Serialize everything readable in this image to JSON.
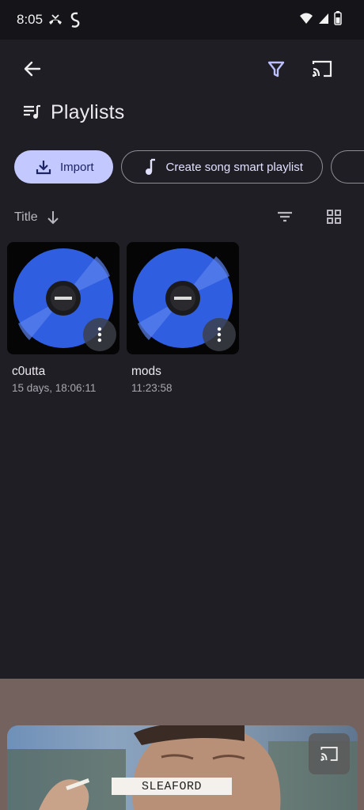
{
  "status": {
    "time": "8:05",
    "icons": [
      "missed-call-icon",
      "shazam-icon",
      "wifi-icon",
      "signal-icon",
      "battery-icon"
    ]
  },
  "appbar": {
    "icons": [
      "back-arrow-icon",
      "filter-funnel-icon",
      "cast-icon"
    ]
  },
  "page": {
    "title": "Playlists"
  },
  "chips": [
    {
      "label": "Import",
      "icon": "download-icon"
    },
    {
      "label": "Create song smart playlist",
      "icon": "music-note-icon"
    }
  ],
  "sort": {
    "label": "Title",
    "direction_icon": "arrow-down-icon"
  },
  "playlists": [
    {
      "title": "c0utta",
      "duration": "15 days, 18:06:11"
    },
    {
      "title": "mods",
      "duration": "11:23:58"
    }
  ],
  "now_playing": {
    "banner_text": "SLEAFORD"
  },
  "colors": {
    "background": "#1f1e24",
    "import_chip": "#c3c9ff",
    "record_blue": "#2f5fe0",
    "bottom_area": "#74625f"
  }
}
